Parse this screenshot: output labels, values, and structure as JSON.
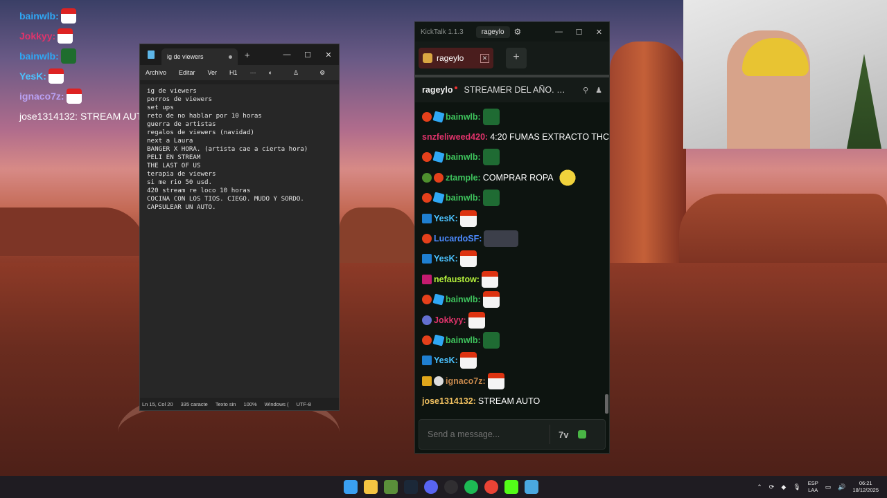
{
  "desktop_chat": [
    {
      "user": "bainwlb",
      "color": "#2fa8f5",
      "emote": "santa"
    },
    {
      "user": "Jokkyy",
      "color": "#e0336b",
      "emote": "santa"
    },
    {
      "user": "bainwlb",
      "color": "#2fa8f5",
      "emote": "grinch"
    },
    {
      "user": "YesK",
      "color": "#4cc3ff",
      "emote": "santa"
    },
    {
      "user": "ignaco7z",
      "color": "#b9a1f3",
      "emote": "santa"
    },
    {
      "user": "jose1314132",
      "color": "#f0c060",
      "text": "STREAM AUTO"
    }
  ],
  "notepad": {
    "tab_title": "ig de viewers",
    "menu": [
      "Archivo",
      "Editar",
      "Ver"
    ],
    "heading": "H1",
    "more": "···",
    "lines": [
      "ig de viewers",
      "porros de viewers",
      "set ups",
      "reto de no hablar por 10 horas",
      "guerra de artistas",
      "regalos de viewers (navidad)",
      "next a Laura",
      "BANGER X HORA. (artista cae a cierta hora)",
      "PELI EN STREAM",
      "THE LAST OF US",
      "terapia de viewers",
      "si me rio 50 usd.",
      "420 stream re loco 10 horas",
      "COCINA CON LOS TIOS. CIEGO. MUDO Y SORDO.",
      "CAPSULEAR UN AUTO."
    ],
    "status": [
      "Ln 15, Col 20",
      "335 caracte",
      "Texto sin",
      "100%",
      "Windows (",
      "UTF-8"
    ]
  },
  "kicktalk": {
    "app_title": "KickTalk 1.1.3",
    "channel_pill": "rageylo",
    "tab_label": "rageylo",
    "header_name": "rageylo",
    "stream_title": "STREAMER DEL AÑO. G...",
    "input_placeholder": "Send a message...",
    "messages": [
      {
        "badges": [
          "fire",
          "cube"
        ],
        "user": "bainwlb",
        "color": "#3ec45d",
        "emote": "grinch"
      },
      {
        "badges": [],
        "user": "snzfeliweed420",
        "color": "#e0336b",
        "text": "4:20 FUMAS EXTRACTO THC"
      },
      {
        "badges": [
          "fire",
          "cube"
        ],
        "user": "bainwlb",
        "color": "#3ec45d",
        "emote": "grinch"
      },
      {
        "badges": [
          "alien",
          "fire"
        ],
        "user": "ztample",
        "color": "#3ec45d",
        "text": "COMPRAR ROPA",
        "emote": "face"
      },
      {
        "badges": [
          "fire",
          "cube"
        ],
        "user": "bainwlb",
        "color": "#3ec45d",
        "emote": "grinch"
      },
      {
        "badges": [
          "sword"
        ],
        "user": "YesK",
        "color": "#4cc3ff",
        "emote": "santa"
      },
      {
        "badges": [
          "fire"
        ],
        "user": "LucardoSF",
        "color": "#4c8bff",
        "emote": "group"
      },
      {
        "badges": [
          "sword"
        ],
        "user": "YesK",
        "color": "#4cc3ff",
        "emote": "santa"
      },
      {
        "badges": [
          "pink"
        ],
        "user": "nefaustow",
        "color": "#b5f23b",
        "emote": "santa"
      },
      {
        "badges": [
          "fire",
          "cube"
        ],
        "user": "bainwlb",
        "color": "#3ec45d",
        "emote": "santa"
      },
      {
        "badges": [
          "eye"
        ],
        "user": "Jokkyy",
        "color": "#e0336b",
        "emote": "santa"
      },
      {
        "badges": [
          "fire",
          "cube"
        ],
        "user": "bainwlb",
        "color": "#3ec45d",
        "emote": "grinch"
      },
      {
        "badges": [
          "sword"
        ],
        "user": "YesK",
        "color": "#4cc3ff",
        "emote": "santa"
      },
      {
        "badges": [
          "seven",
          "skull"
        ],
        "user": "ignaco7z",
        "color": "#c6884c",
        "emote": "santa"
      },
      {
        "badges": [],
        "user": "jose1314132",
        "color": "#f0c060",
        "text": "STREAM AUTO"
      }
    ]
  },
  "taskbar": {
    "lang_top": "ESP",
    "lang_bottom": "LAA",
    "time": "06:21",
    "date": "18/12/2025",
    "apps": [
      "windows-start",
      "file-explorer",
      "minecraft",
      "steam",
      "discord",
      "obs",
      "spotify",
      "chrome",
      "kick",
      "notepad"
    ]
  }
}
